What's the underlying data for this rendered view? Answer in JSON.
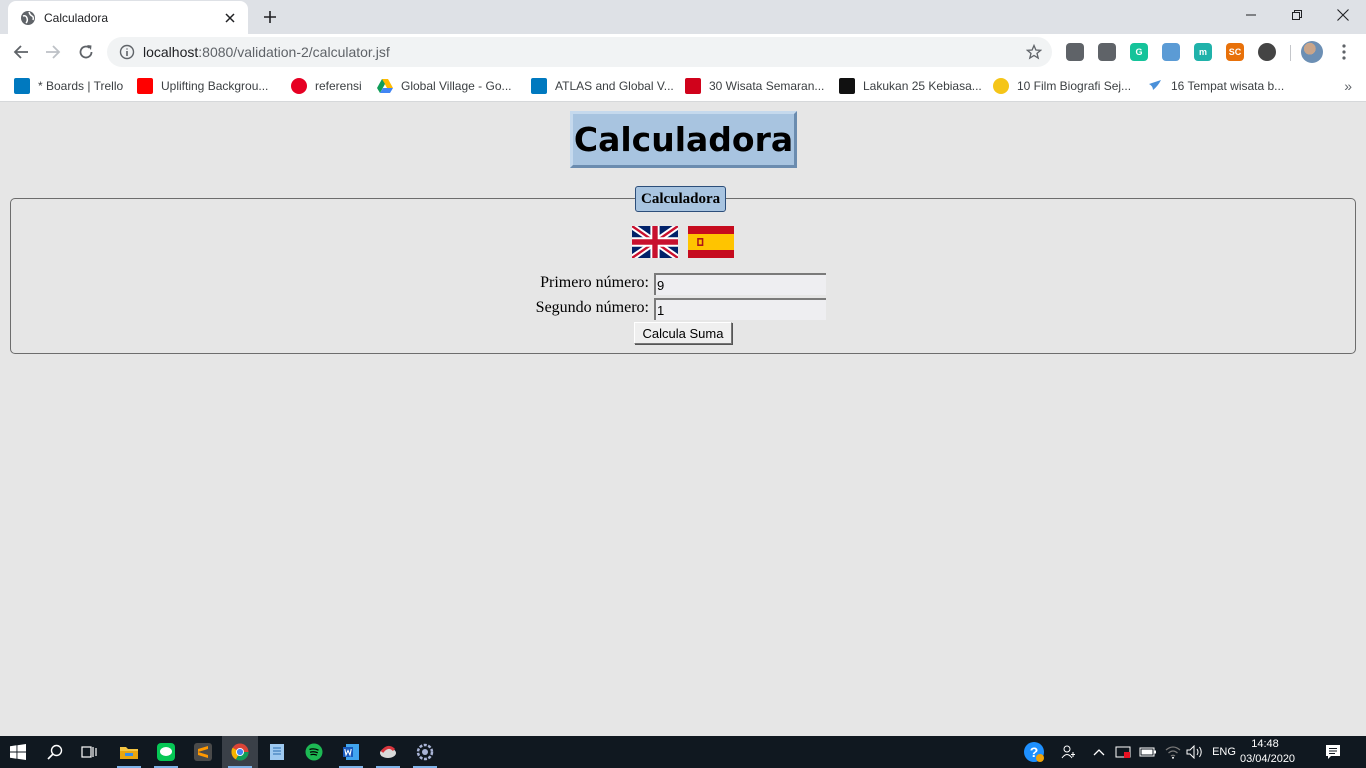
{
  "browser": {
    "tab": {
      "title": "Calculadora",
      "favicon": "globe-icon"
    },
    "url": {
      "host": "localhost",
      "path": ":8080/validation-2/calculator.jsf"
    },
    "window_controls": [
      "minimize-icon",
      "restore-icon",
      "close-icon"
    ],
    "extensions": [
      {
        "name": "chat-extension-icon",
        "color": "#5f6368",
        "label": ""
      },
      {
        "name": "cube-extension-icon",
        "color": "#5f6368",
        "label": ""
      },
      {
        "name": "grammarly-extension-icon",
        "color": "#15c39a",
        "label": "G"
      },
      {
        "name": "feather-extension-icon",
        "color": "#5b9bd5",
        "label": ""
      },
      {
        "name": "m-extension-icon",
        "color": "#20b2aa",
        "label": "m"
      },
      {
        "name": "sc-extension-icon",
        "color": "#e8710a",
        "label": "SC"
      },
      {
        "name": "circle-extension-icon",
        "color": "#444444",
        "label": ""
      }
    ],
    "bookmarks": [
      {
        "label": "* Boards | Trello",
        "icon": "trello-icon",
        "color": "#0079bf"
      },
      {
        "label": "Uplifting Backgrou...",
        "icon": "youtube-icon",
        "color": "#ff0000"
      },
      {
        "label": "referensi",
        "icon": "pinterest-icon",
        "color": "#e60023"
      },
      {
        "label": "Global Village - Go...",
        "icon": "google-drive-icon",
        "color": "#1fa463"
      },
      {
        "label": "ATLAS and Global V...",
        "icon": "trello-icon",
        "color": "#0079bf"
      },
      {
        "label": "30 Wisata Semaran...",
        "icon": "m-bookmark-icon",
        "color": "#d0021b"
      },
      {
        "label": "Lakukan 25 Kebiasa...",
        "icon": "m-black-icon",
        "color": "#111111"
      },
      {
        "label": "10 Film Biografi Sej...",
        "icon": "z-icon",
        "color": "#f5c518"
      },
      {
        "label": "16 Tempat wisata b...",
        "icon": "bird-icon",
        "color": "#4a90d9"
      }
    ]
  },
  "page": {
    "heading": "Calculadora",
    "legend": "Calculadora",
    "flags": [
      "uk-flag-icon",
      "spain-flag-icon"
    ],
    "first_label": "Primero número:",
    "first_value": "9",
    "second_label": "Segundo número:",
    "second_value": "1",
    "button_label": "Calcula Suma"
  },
  "taskbar": {
    "apps": [
      "start-icon",
      "search-icon",
      "task-view-icon",
      "file-explorer-icon",
      "line-app-icon",
      "sublime-text-icon",
      "chrome-icon",
      "notes-app-icon",
      "spotify-icon",
      "word-icon",
      "app-icon",
      "settings-app-icon"
    ],
    "language": "ENG",
    "time": "14:48",
    "date": "03/04/2020"
  }
}
